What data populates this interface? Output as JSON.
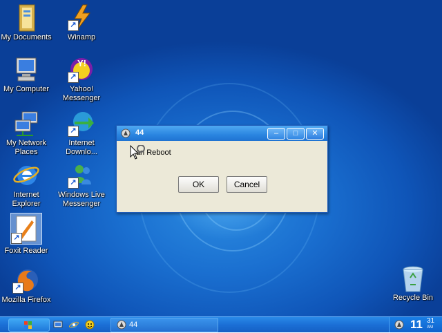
{
  "desktop": {
    "icons": [
      {
        "label": "My Documents",
        "icon": "folder-documents-icon"
      },
      {
        "label": "My Computer",
        "icon": "computer-icon"
      },
      {
        "label": "My Network\nPlaces",
        "icon": "network-icon"
      },
      {
        "label": "Internet\nExplorer",
        "icon": "internet-explorer-icon"
      },
      {
        "label": "Foxit Reader",
        "icon": "foxit-reader-icon"
      },
      {
        "label": "Mozilla Firefox",
        "icon": "firefox-icon"
      },
      {
        "label": "Winamp",
        "icon": "winamp-icon"
      },
      {
        "label": "Yahoo!\nMessenger",
        "icon": "yahoo-messenger-icon"
      },
      {
        "label": "Internet\nDownlo...",
        "icon": "internet-download-manager-icon"
      },
      {
        "label": "Windows Live\nMessenger",
        "icon": "windows-live-messenger-icon"
      },
      {
        "label": "Recycle Bin",
        "icon": "recycle-bin-icon"
      }
    ]
  },
  "dialog": {
    "title": "44",
    "message": "Can  Reboot",
    "ok_label": "OK",
    "cancel_label": "Cancel",
    "minimize_symbol": "–",
    "maximize_symbol": "□",
    "close_symbol": "✕"
  },
  "taskbar": {
    "task_item_label": "44",
    "clock_hour": "11",
    "clock_minute": "31",
    "clock_ampm": "AM"
  },
  "colors": {
    "desktop_blue": "#1a6fd0",
    "titlebar_blue": "#2a85e0",
    "dialog_bg": "#ece9d8"
  }
}
